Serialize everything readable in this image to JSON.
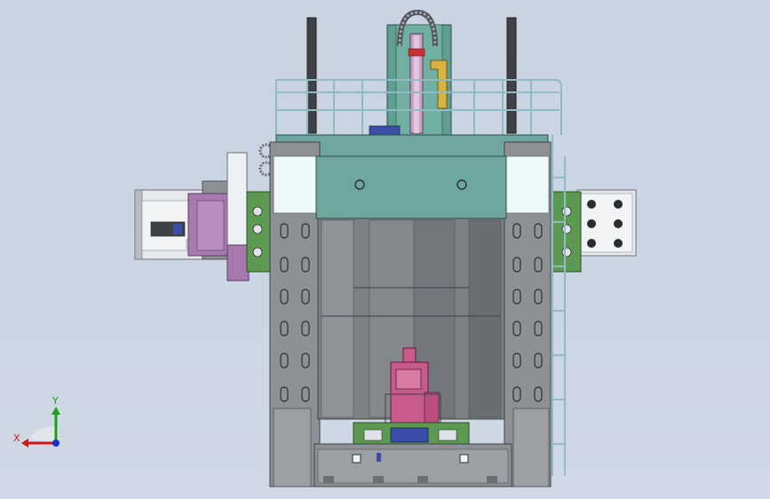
{
  "viewport": {
    "background_top": "#c9d3e2",
    "background_bottom": "#d0d8e5"
  },
  "triad": {
    "x_label": "X",
    "y_label": "Y",
    "x_color": "#d01818",
    "y_color": "#18a018",
    "z_color": "#1830d0"
  },
  "colors": {
    "frame_gray": "#8d9196",
    "dark_gray": "#6c7075",
    "crossbeam_teal": "#6fa6a0",
    "column_teal": "#5f9e90",
    "spindle_pink": "#c85a8c",
    "ram_purple": "#a878b0",
    "pcb_green": "#5c9a52",
    "rail_dark": "#3e4247",
    "cyan_highlight": "#e8f7fb",
    "yellow_part": "#d9b340"
  }
}
